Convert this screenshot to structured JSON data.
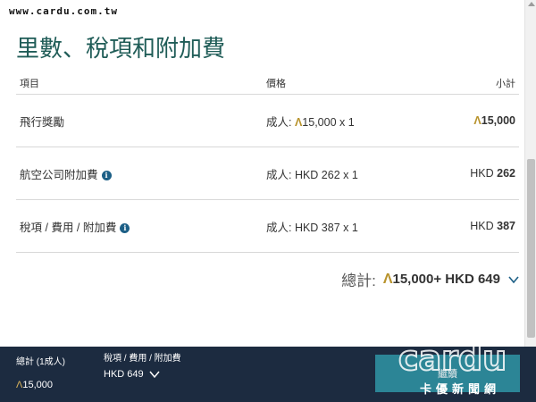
{
  "watermark_url": "www.cardu.com.tw",
  "page_title": "里數、稅項和附加費",
  "table": {
    "headers": {
      "item": "項目",
      "price": "價格",
      "subtotal": "小計"
    },
    "rows": [
      {
        "item": "飛行獎勵",
        "info": false,
        "price_prefix": "成人: ",
        "price_avios": "15,000",
        "price_suffix": " x 1",
        "sub_prefix": "",
        "sub_value": "15,000",
        "sub_is_avios": true
      },
      {
        "item": "航空公司附加費",
        "info": true,
        "price_prefix": "成人: HKD 262",
        "price_avios": "",
        "price_suffix": " x 1",
        "sub_prefix": "HKD ",
        "sub_value": "262",
        "sub_is_avios": false
      },
      {
        "item": "稅項 / 費用 / 附加費",
        "info": true,
        "price_prefix": "成人: HKD 387",
        "price_avios": "",
        "price_suffix": " x 1",
        "sub_prefix": "HKD ",
        "sub_value": "387",
        "sub_is_avios": false
      }
    ]
  },
  "total": {
    "label": "總計:",
    "avios": "15,000",
    "plus": " + HKD 649"
  },
  "footer": {
    "total_label": "總計 (1成人)",
    "total_value": "15,000",
    "tax_label": "稅項 / 費用 / 附加費",
    "tax_value": "HKD 649",
    "continue_label": "繼續"
  },
  "logo": {
    "text": "cardu",
    "subtitle": "卡優新聞網"
  },
  "colors": {
    "title": "#1f5c57",
    "avios": "#b8932c",
    "footer_bg": "#1c2b40",
    "button": "#2e8fa0",
    "info_icon": "#1c5f86"
  },
  "icons": {
    "avios": "avios-icon",
    "info": "info-icon",
    "chevron": "chevron-down-icon"
  }
}
